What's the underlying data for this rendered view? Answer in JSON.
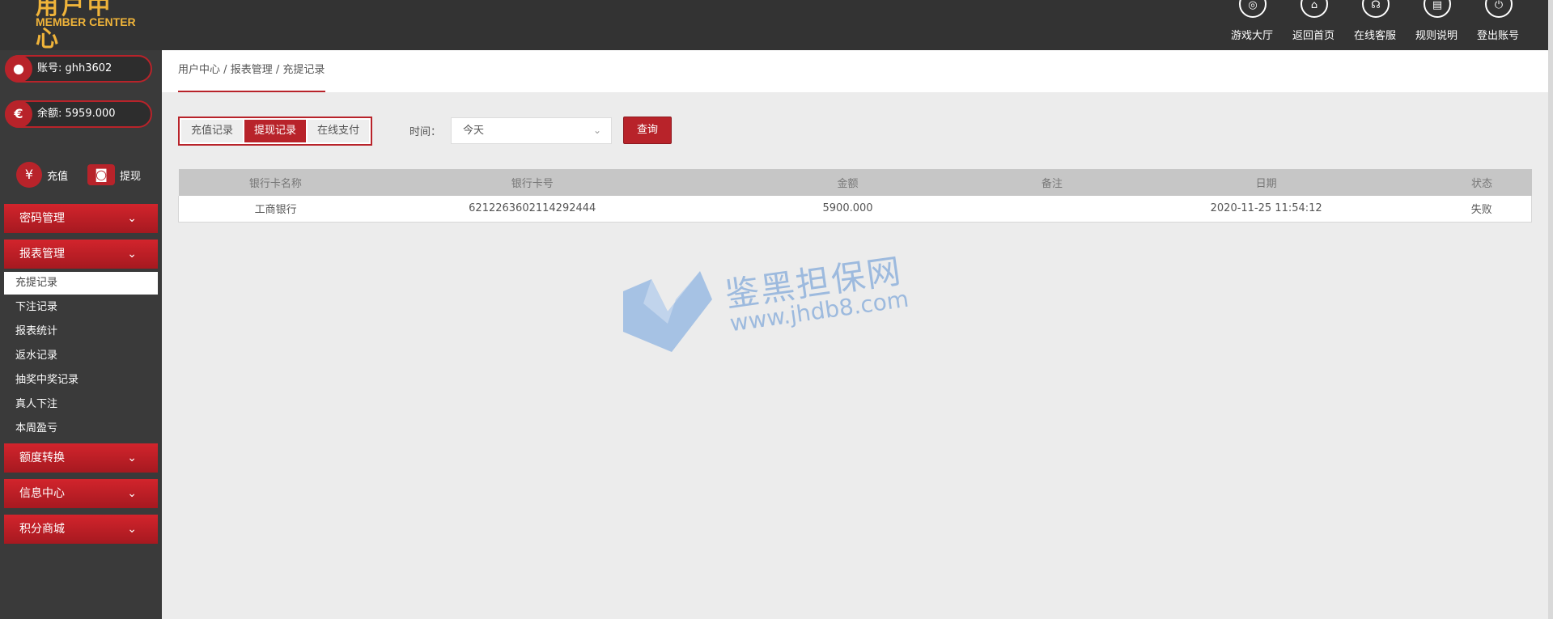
{
  "logo": {
    "cn": "用户中心",
    "en": "MEMBER CENTER"
  },
  "topnav": [
    {
      "label": "游戏大厅",
      "icon": "game-hall-icon",
      "glyph": "◎"
    },
    {
      "label": "返回首页",
      "icon": "home-icon",
      "glyph": "⌂"
    },
    {
      "label": "在线客服",
      "icon": "headset-icon",
      "glyph": "☊"
    },
    {
      "label": "规则说明",
      "icon": "document-icon",
      "glyph": "▤"
    },
    {
      "label": "登出账号",
      "icon": "power-icon",
      "glyph": "⏻"
    }
  ],
  "account": {
    "label": "账号: ghh3602",
    "balance": "余额: 5959.000"
  },
  "quick": {
    "deposit": "充值",
    "withdraw": "提现"
  },
  "sidebar": {
    "menus": [
      {
        "label": "密码管理"
      },
      {
        "label": "报表管理"
      },
      {
        "label": "额度转换"
      },
      {
        "label": "信息中心"
      },
      {
        "label": "积分商城"
      }
    ],
    "report_items": [
      "充提记录",
      "下注记录",
      "报表统计",
      "返水记录",
      "抽奖中奖记录",
      "真人下注",
      "本周盈亏"
    ]
  },
  "breadcrumb": {
    "root": "用户中心",
    "section": "报表管理",
    "page": "充提记录",
    "sep": "/"
  },
  "filters": {
    "tabs": [
      "充值记录",
      "提现记录",
      "在线支付"
    ],
    "active_tab": 1,
    "time_label": "时间：",
    "time_value": "今天",
    "query": "查询"
  },
  "table": {
    "columns": [
      "银行卡名称",
      "银行卡号",
      "金额",
      "备注",
      "日期",
      "状态"
    ],
    "rows": [
      [
        "工商银行",
        "6212263602114292444",
        "5900.000",
        "",
        "2020-11-25 11:54:12",
        "失败"
      ]
    ]
  },
  "watermark": {
    "title": "鉴黑担保网",
    "url": "www.jhdb8.com"
  },
  "colors": {
    "accent": "#b8232a",
    "topbar": "#333333",
    "sidebar": "#3a3a3a"
  }
}
